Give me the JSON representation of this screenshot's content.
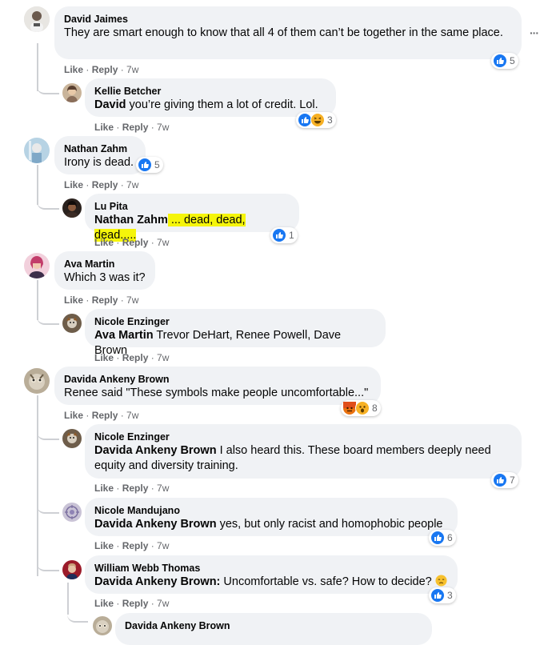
{
  "comments": [
    {
      "name": "David Jaimes",
      "text": "They are smart enough to know that all 4 of them can’t be together in the same place.",
      "like": "Like",
      "reply": "Reply",
      "time": "7w",
      "reactions": "5"
    },
    {
      "name": "Kellie Betcher",
      "mention": "David",
      "text": " you’re giving them a lot of credit. Lol.",
      "like": "Like",
      "reply": "Reply",
      "time": "7w",
      "reactions": "3"
    },
    {
      "name": "Nathan Zahm",
      "text": "Irony is dead.",
      "like": "Like",
      "reply": "Reply",
      "time": "7w",
      "reactions": "5"
    },
    {
      "name": "Lu Pita",
      "mention": "Nathan Zahm",
      "text": " ... dead, dead, dead.....",
      "like": "Like",
      "reply": "Reply",
      "time": "7w",
      "reactions": "1"
    },
    {
      "name": "Ava Martin",
      "text": "Which 3 was it?",
      "like": "Like",
      "reply": "Reply",
      "time": "7w"
    },
    {
      "name": "Nicole Enzinger",
      "mention": "Ava Martin",
      "text": " Trevor DeHart, Renee Powell, Dave Brown",
      "like": "Like",
      "reply": "Reply",
      "time": "7w"
    },
    {
      "name": "Davida Ankeny Brown",
      "text": "Renee said \"These symbols make people uncomfortable...\"",
      "like": "Like",
      "reply": "Reply",
      "time": "7w",
      "reactions": "8"
    },
    {
      "name": "Nicole Enzinger",
      "mention": "Davida Ankeny Brown",
      "text": " I also heard this. These board members deeply need equity and diversity training.",
      "like": "Like",
      "reply": "Reply",
      "time": "7w",
      "reactions": "7"
    },
    {
      "name": "Nicole Mandujano",
      "mention": "Davida Ankeny Brown",
      "text": " yes, but only racist and homophobic people",
      "like": "Like",
      "reply": "Reply",
      "time": "7w",
      "reactions": "6"
    },
    {
      "name": "William Webb Thomas",
      "mention": "Davida Ankeny Brown:",
      "text": " Uncomfortable vs. safe? How to decide? ",
      "like": "Like",
      "reply": "Reply",
      "time": "7w",
      "reactions": "3"
    },
    {
      "name": "Davida Ankeny Brown"
    }
  ],
  "menu_glyph": "···",
  "colors": {
    "bubble": "#f0f2f5",
    "like": "#1877f2",
    "meta": "#65676b",
    "highlight": "#f5f50a"
  }
}
